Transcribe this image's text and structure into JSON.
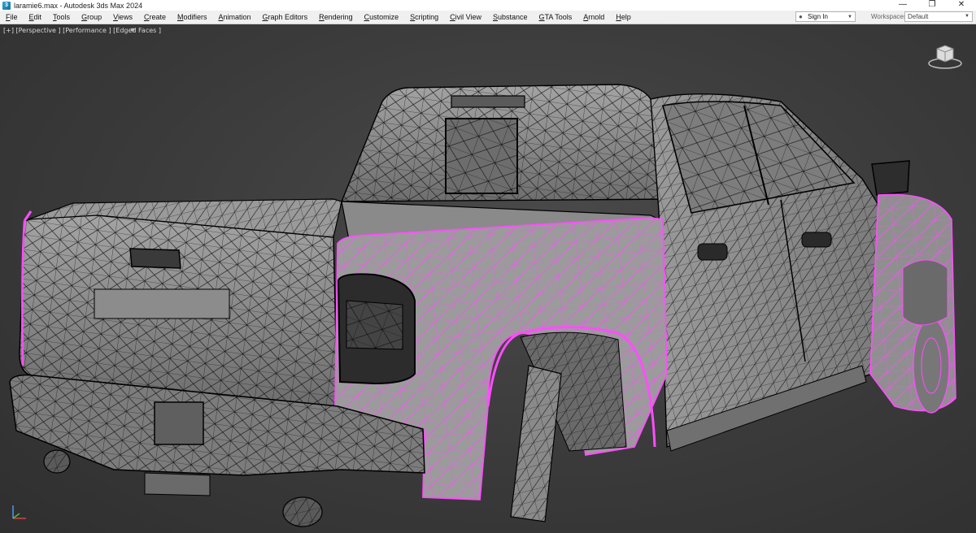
{
  "window": {
    "title": "laramie6.max - Autodesk 3ds Max 2024",
    "app_icon_glyph": "3",
    "minimize_glyph": "—",
    "restore_glyph": "❐",
    "close_glyph": "✕"
  },
  "menu": {
    "items": [
      "File",
      "Edit",
      "Tools",
      "Group",
      "Views",
      "Create",
      "Modifiers",
      "Animation",
      "Graph Editors",
      "Rendering",
      "Customize",
      "Scripting",
      "Civil View",
      "Substance",
      "GTA Tools",
      "Arnold",
      "Help"
    ]
  },
  "account": {
    "signin_label": "Sign In",
    "user_icon": "user-icon"
  },
  "workspace": {
    "label": "Workspaces:",
    "selected": "Default"
  },
  "viewport": {
    "label": "[+] [Perspective ] [Performance ] [Edged Faces ]",
    "filter_icon": "filter-icon",
    "shading": "edged-faces",
    "background_color": "#3c3c3c",
    "wire_color": "#000000",
    "selection_wire_color": "#ff4dff",
    "surface_color": "#8a8a8a"
  },
  "colors": {
    "titlebar": "#ffffff",
    "menubar": "#f0f0f0",
    "selection": "#ff4dff"
  }
}
